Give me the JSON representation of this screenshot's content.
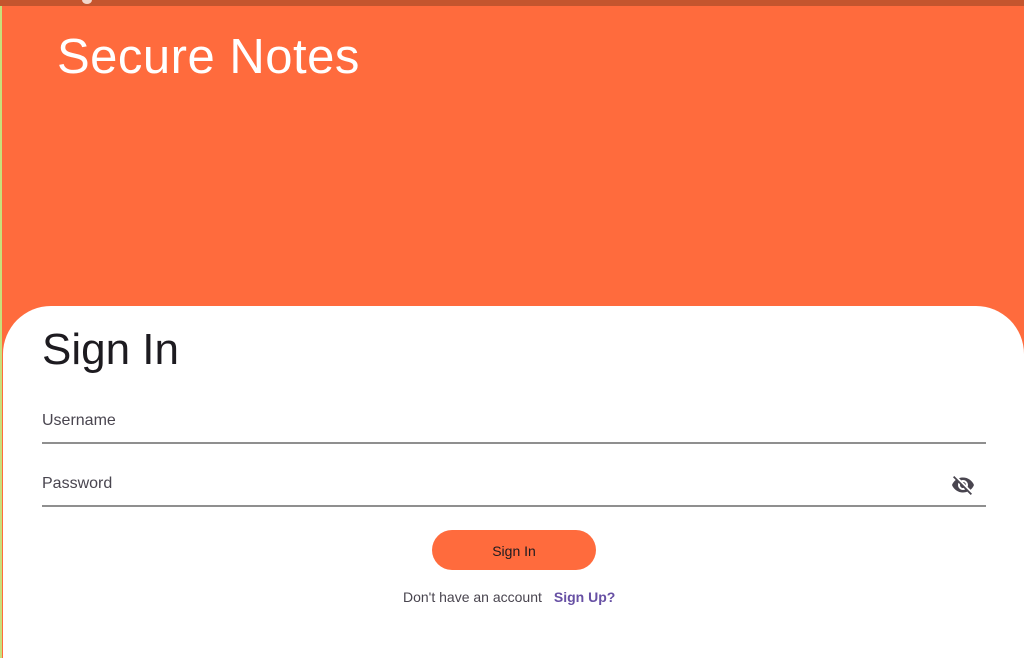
{
  "app": {
    "title": "Secure Notes"
  },
  "login_card": {
    "heading": "Sign In",
    "username_label": "Username",
    "username_value": "",
    "password_label": "Password",
    "password_value": "",
    "password_visibility_icon": "visibility-off-icon",
    "signin_label": "Sign In",
    "no_account_text": "Don't have an account",
    "signup_link": "Sign Up?"
  },
  "colors": {
    "header_background": "#FF6B3D",
    "status_bar": "#C4552E",
    "card_background": "#FFFFFF",
    "button_background": "#FF6B3D",
    "link_color": "#6750A4",
    "field_underline": "#8F8F8F"
  }
}
